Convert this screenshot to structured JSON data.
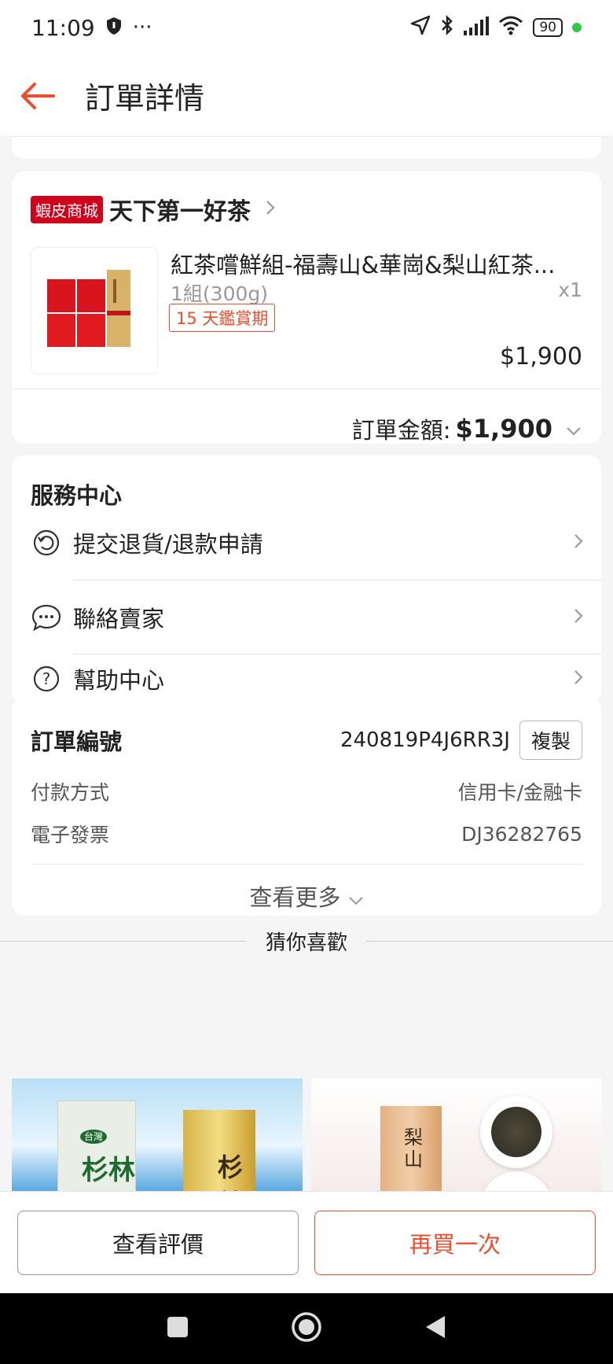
{
  "status_bar": {
    "time": "11:09",
    "battery": "90"
  },
  "header": {
    "title": "訂單詳情"
  },
  "order_card": {
    "mall_badge": "蝦皮商城",
    "shop_name": "天下第一好茶",
    "product": {
      "name": "紅茶嚐鮮組-福壽山&華崗&梨山紅茶...",
      "variant": "1組(300g)",
      "quantity": "x1",
      "badge": "15 天鑑賞期",
      "price": "$1,900"
    },
    "total_label": "訂單金額:",
    "total_value": "$1,900"
  },
  "service_center": {
    "title": "服務中心",
    "items": [
      {
        "label": "提交退貨/退款申請",
        "icon": "return-icon"
      },
      {
        "label": "聯絡賣家",
        "icon": "chat-icon"
      },
      {
        "label": "幫助中心",
        "icon": "help-icon"
      }
    ]
  },
  "order_info": {
    "order_number_label": "訂單編號",
    "order_number": "240819P4J6RR3J",
    "copy_label": "複製",
    "payment_label": "付款方式",
    "payment_value": "信用卡/金融卡",
    "invoice_label": "電子發票",
    "invoice_value": "DJ36282765",
    "see_more": "查看更多"
  },
  "recommend": {
    "title": "猜你喜歡",
    "left_text": "杉林",
    "left_tag": "台灣",
    "right_text": "梨山"
  },
  "bottom_bar": {
    "review_label": "查看評價",
    "rebuy_label": "再買一次"
  },
  "colors": {
    "accent": "#ee4d2d",
    "mall_red": "#d0011b"
  }
}
